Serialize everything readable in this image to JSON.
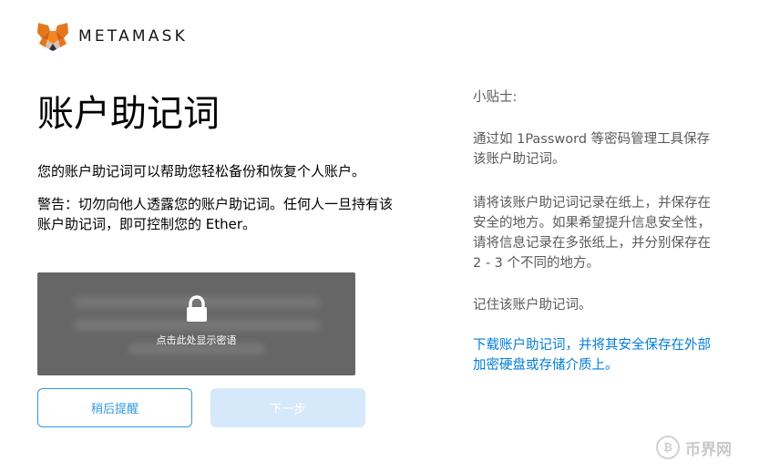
{
  "header": {
    "brand": "METAMASK",
    "logo_icon": "metamask-fox-icon"
  },
  "main": {
    "title": "账户助记词",
    "description": "您的账户助记词可以帮助您轻松备份和恢复个人账户。",
    "warning": "警告：切勿向他人透露您的账户助记词。任何人一旦持有该账户助记词，即可控制您的 Ether。",
    "reveal": {
      "lock_icon": "lock-icon",
      "label": "点击此处显示密语"
    },
    "buttons": {
      "remind_later": "稍后提醒",
      "next": "下一步"
    }
  },
  "tips": {
    "label": "小贴士:",
    "items": [
      "通过如 1Password 等密码管理工具保存该账户助记词。",
      "请将该账户助记词记录在纸上，并保存在安全的地方。如果希望提升信息安全性，请将信息记录在多张纸上，并分别保存在 2 - 3 个不同的地方。",
      "记住该账户助记词。",
      "下载账户助记词，并将其安全保存在外部加密硬盘或存储介质上。"
    ]
  },
  "watermark": {
    "text": "币界网",
    "icon": "bitcoin-coin-icon"
  },
  "colors": {
    "accent": "#037dd6",
    "button_outline": "#2f9ae0",
    "disabled_button": "#d6e9fa",
    "reveal_overlay": "#666666"
  }
}
